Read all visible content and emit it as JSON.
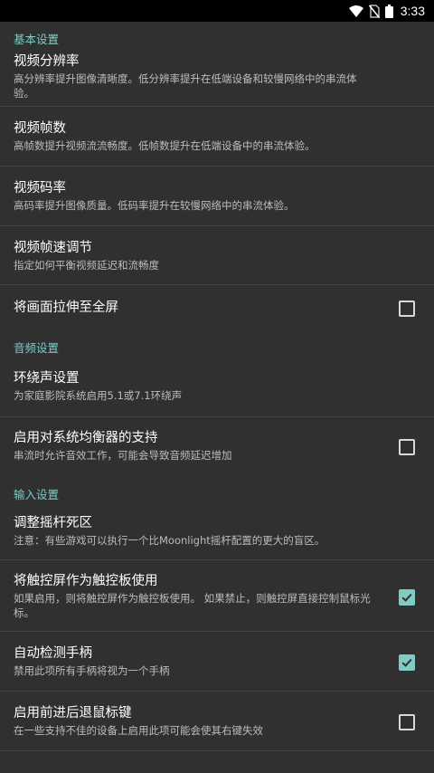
{
  "status_bar": {
    "time": "3:33",
    "icons": [
      "wifi-icon",
      "no-sim-icon",
      "battery-icon"
    ]
  },
  "colors": {
    "accent": "#80cbc4",
    "background": "#303030",
    "divider": "#454545"
  },
  "sections": {
    "basic": {
      "header": "基本设置",
      "resolution": {
        "title": "视频分辨率",
        "summary": "高分辨率提升图像清晰度。低分辨率提升在低端设备和较慢网络中的串流体验。"
      },
      "fps": {
        "title": "视频帧数",
        "summary": "高帧数提升视频流流畅度。低帧数提升在低端设备中的串流体验。"
      },
      "bitrate": {
        "title": "视频码率",
        "summary": "高码率提升图像质量。低码率提升在较慢网络中的串流体验。"
      },
      "frame_pacing": {
        "title": "视频帧速调节",
        "summary": "指定如何平衡视频延迟和流畅度"
      },
      "stretch": {
        "title": "将画面拉伸至全屏",
        "checked": false
      }
    },
    "audio": {
      "header": "音频设置",
      "surround": {
        "title": "环绕声设置",
        "summary": "为家庭影院系统启用5.1或7.1环绕声"
      },
      "equalizer": {
        "title": "启用对系统均衡器的支持",
        "summary": "串流时允许音效工作，可能会导致音频延迟增加",
        "checked": false
      }
    },
    "input": {
      "header": "输入设置",
      "deadzone": {
        "title": "调整摇杆死区",
        "summary": "注意：有些游戏可以执行一个比Moonlight摇杆配置的更大的盲区。"
      },
      "touchpad": {
        "title": "将触控屏作为触控板使用",
        "summary": "如果启用，则将触控屏作为触控板使用。 如果禁止，则触控屏直接控制鼠标光标。",
        "checked": true
      },
      "auto_detect": {
        "title": "自动检测手柄",
        "summary": "禁用此项所有手柄将视为一个手柄",
        "checked": true
      },
      "mouse_buttons": {
        "title": "启用前进后退鼠标键",
        "summary": "在一些支持不佳的设备上启用此项可能会使其右键失效",
        "checked": false
      }
    }
  }
}
